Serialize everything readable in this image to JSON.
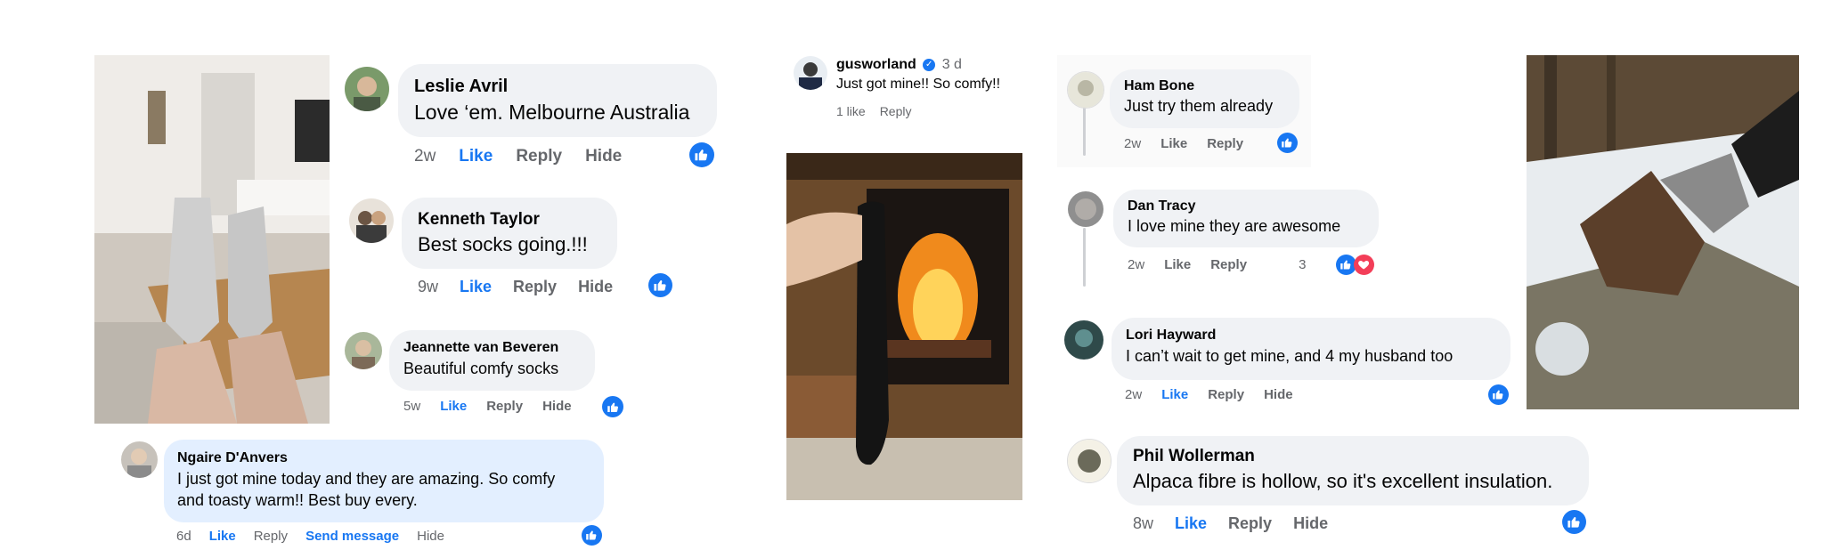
{
  "panel_left": {
    "comments": [
      {
        "name": "Leslie Avril",
        "text": "Love ‘em. Melbourne Australia",
        "time": "2w",
        "like": "Like",
        "reply": "Reply",
        "hide": "Hide"
      },
      {
        "name": "Kenneth Taylor",
        "text": "Best socks going.!!!",
        "time": "9w",
        "like": "Like",
        "reply": "Reply",
        "hide": "Hide"
      },
      {
        "name": "Jeannette van Beveren",
        "text": "Beautiful comfy socks",
        "time": "5w",
        "like": "Like",
        "reply": "Reply",
        "hide": "Hide"
      },
      {
        "name": "Ngaire D'Anvers",
        "text_line1": "I just got mine today and they are amazing. So comfy",
        "text_line2": "and toasty warm!! Best buy every.",
        "time": "6d",
        "like": "Like",
        "reply": "Reply",
        "send": "Send message",
        "hide": "Hide"
      }
    ]
  },
  "panel_middle": {
    "name": "gusworland",
    "time": "3 d",
    "text": "Just got mine!! So comfy!!",
    "likes": "1 like",
    "reply": "Reply"
  },
  "panel_right": {
    "comments": [
      {
        "name": "Ham Bone",
        "text": "Just try them already",
        "time": "2w",
        "like": "Like",
        "reply": "Reply"
      },
      {
        "name": "Dan Tracy",
        "text": "I love mine they are awesome",
        "time": "2w",
        "like": "Like",
        "reply": "Reply",
        "reaction_count": "3"
      },
      {
        "name": "Lori Hayward",
        "text": "I can’t wait to get mine, and 4 my husband too",
        "time": "2w",
        "like": "Like",
        "reply": "Reply",
        "hide": "Hide"
      },
      {
        "name": "Phil Wollerman",
        "text": "Alpaca fibre is hollow, so it's excellent insulation.",
        "time": "8w",
        "like": "Like",
        "reply": "Reply",
        "hide": "Hide"
      }
    ]
  },
  "colors": {
    "like_blue": "#1877f2",
    "bubble": "#f0f2f5",
    "bubble_highlight": "#e3efff",
    "meta_gray": "#65676b",
    "heart": "#f33e58"
  }
}
